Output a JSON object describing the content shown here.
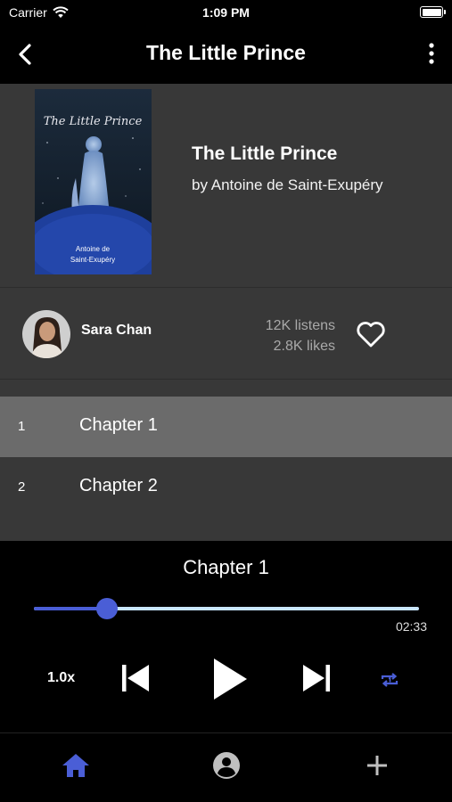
{
  "status_bar": {
    "carrier": "Carrier",
    "time": "1:09 PM"
  },
  "nav": {
    "title": "The Little Prince",
    "back_icon": "chevron-left-icon",
    "more_icon": "more-vertical-icon"
  },
  "book": {
    "title": "The Little Prince",
    "author": "by Antoine de Saint-Exupéry",
    "cover": {
      "title": "The Little Prince",
      "author_line1": "Antoine de",
      "author_line2": "Saint-Exupéry"
    }
  },
  "narrator": {
    "name": "Sara Chan",
    "listens": "12K listens",
    "likes": "2.8K likes"
  },
  "chapters": [
    {
      "number": "1",
      "title": "Chapter 1"
    },
    {
      "number": "2",
      "title": "Chapter 2"
    }
  ],
  "player": {
    "now_playing": "Chapter 1",
    "progress": 0.19,
    "time_remaining": "02:33",
    "speed": "1.0x"
  },
  "colors": {
    "accent": "#4a5ed6",
    "track": "#c9e6ff",
    "panel": "#383838",
    "active_row": "#6b6b6b"
  }
}
